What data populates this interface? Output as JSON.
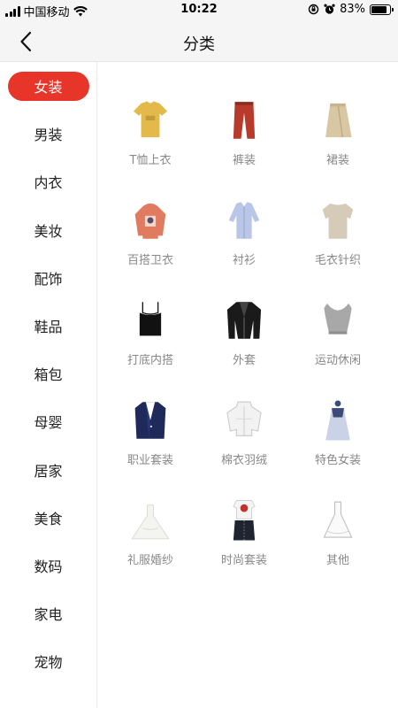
{
  "status_bar": {
    "carrier": "中国移动",
    "time": "10:22",
    "battery": "83%",
    "battery_level": 0.83
  },
  "nav": {
    "title": "分类",
    "back_icon": "chevron-left-icon"
  },
  "sidebar": {
    "items": [
      {
        "label": "女装",
        "active": true
      },
      {
        "label": "男装"
      },
      {
        "label": "内衣"
      },
      {
        "label": "美妆"
      },
      {
        "label": "配饰"
      },
      {
        "label": "鞋品"
      },
      {
        "label": "箱包"
      },
      {
        "label": "母婴"
      },
      {
        "label": "居家"
      },
      {
        "label": "美食"
      },
      {
        "label": "数码"
      },
      {
        "label": "家电"
      },
      {
        "label": "宠物"
      }
    ],
    "active_color": "#e8352a"
  },
  "grid": {
    "items": [
      {
        "label": "T恤上衣",
        "icon": "tshirt-icon"
      },
      {
        "label": "裤装",
        "icon": "pants-icon"
      },
      {
        "label": "裙装",
        "icon": "skirt-icon"
      },
      {
        "label": "百搭卫衣",
        "icon": "hoodie-icon"
      },
      {
        "label": "衬衫",
        "icon": "shirt-icon"
      },
      {
        "label": "毛衣针织",
        "icon": "sweater-icon"
      },
      {
        "label": "打底内搭",
        "icon": "camisole-icon"
      },
      {
        "label": "外套",
        "icon": "jacket-icon"
      },
      {
        "label": "运动休闲",
        "icon": "sports-top-icon"
      },
      {
        "label": "职业套装",
        "icon": "blazer-icon"
      },
      {
        "label": "棉衣羽绒",
        "icon": "down-jacket-icon"
      },
      {
        "label": "特色女装",
        "icon": "dress-icon"
      },
      {
        "label": "礼服婚纱",
        "icon": "wedding-dress-icon"
      },
      {
        "label": "时尚套装",
        "icon": "outfit-set-icon"
      },
      {
        "label": "其他",
        "icon": "gown-icon"
      }
    ]
  }
}
